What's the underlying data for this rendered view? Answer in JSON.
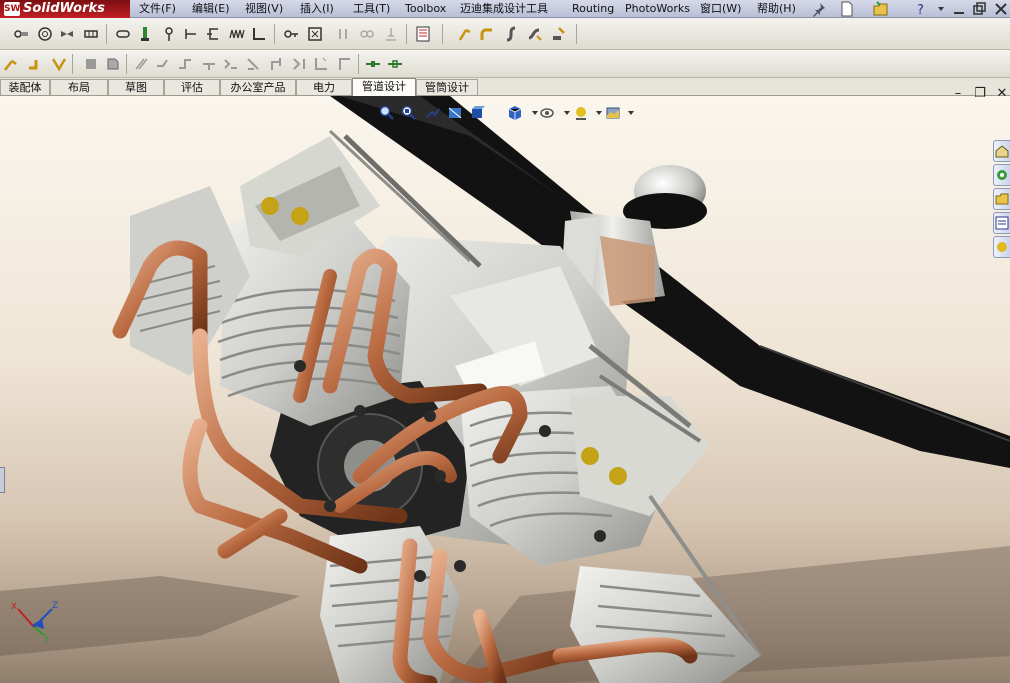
{
  "app": {
    "logo_text": "SolidWorks",
    "logo_badge": "SW"
  },
  "menu": {
    "items": [
      "文件(F)",
      "编辑(E)",
      "视图(V)",
      "插入(I)",
      "工具(T)",
      "Toolbox",
      "迈迪集成设计工具",
      "Routing",
      "PhotoWorks",
      "窗口(W)",
      "帮助(H)"
    ]
  },
  "tabs": {
    "items": [
      "装配体",
      "布局",
      "草图",
      "评估",
      "办公室产品",
      "电力",
      "管道设计",
      "管筒设计"
    ],
    "active": "管道设计"
  },
  "window_controls": {
    "minimize": "–",
    "restore": "❐",
    "close": "✕"
  },
  "triad": {
    "x": "X",
    "y": "Y",
    "z": "Z"
  },
  "colors": {
    "copper": "#b8683f",
    "aluminum": "#d8d8d4",
    "propeller": "#141414",
    "logo_red": "#c21f24",
    "active_tab": "#fdfcf8"
  }
}
